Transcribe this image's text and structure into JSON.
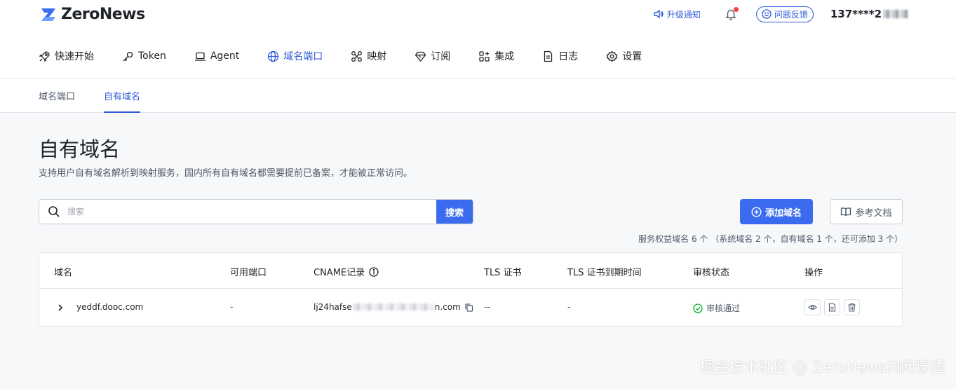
{
  "header": {
    "logo_text": "ZeroNews",
    "notify_label": "升级通知",
    "feedback_label": "问题反馈",
    "user_id": "137****2"
  },
  "nav": {
    "items": [
      {
        "label": "快速开始",
        "icon": "rocket-icon"
      },
      {
        "label": "Token",
        "icon": "key-icon"
      },
      {
        "label": "Agent",
        "icon": "laptop-icon"
      },
      {
        "label": "域名端口",
        "icon": "globe-icon",
        "active": true
      },
      {
        "label": "映射",
        "icon": "mapping-icon"
      },
      {
        "label": "订阅",
        "icon": "diamond-icon"
      },
      {
        "label": "集成",
        "icon": "grid-icon"
      },
      {
        "label": "日志",
        "icon": "file-icon"
      },
      {
        "label": "设置",
        "icon": "gear-icon"
      }
    ]
  },
  "subnav": {
    "tabs": [
      {
        "label": "域名端口",
        "active": false
      },
      {
        "label": "自有域名",
        "active": true
      }
    ]
  },
  "page": {
    "title": "自有域名",
    "description": "支持用户自有域名解析到映射服务，国内所有自有域名都需要提前已备案，才能被正常访问。"
  },
  "search": {
    "placeholder": "搜索",
    "value": "",
    "button": "搜索"
  },
  "actions": {
    "add_domain": "添加域名",
    "docs": "参考文档"
  },
  "quota_text": "服务权益域名 6 个 （系统域名 2 个，自有域名 1 个，还可添加 3 个）",
  "table": {
    "columns": [
      "域名",
      "可用端口",
      "CNAME记录",
      "TLS 证书",
      "TLS 证书到期时间",
      "审核状态",
      "操作"
    ],
    "rows": [
      {
        "domain": "yeddf.dooc.com",
        "ports": "-",
        "cname_start": "lj24hafse",
        "cname_end": "n.com",
        "tls": "--",
        "tls_expire": "-",
        "status": "审核通过"
      }
    ]
  },
  "watermark": "掘金技术社区 @ ZeroNews内网穿透",
  "colors": {
    "accent": "#3b6cf0",
    "success": "#00b42a",
    "alert": "#f53f3f"
  }
}
